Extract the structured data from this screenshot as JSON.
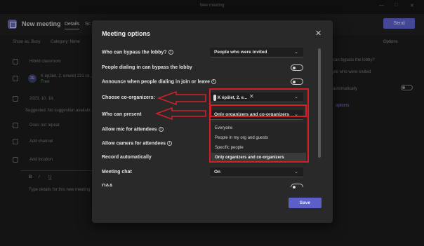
{
  "window": {
    "title": "New meeting"
  },
  "header": {
    "title": "New meeting",
    "tabs": [
      {
        "label": "Details"
      },
      {
        "label": "Sc"
      }
    ],
    "send_label": "Send"
  },
  "background": {
    "show_as": "Show as: Busy",
    "category": "Category: None",
    "title_field": "Hibrid classroom",
    "attendees": "K épület, 2. emelet 221 ok...",
    "attendees_sub": "Free",
    "date": "2023. 10. 18.",
    "suggested": "Suggested: No suggestion availabl...",
    "repeat": "Does not repeat",
    "add_channel": "Add channel",
    "add_location": "Add location",
    "editor_placeholder": "Type details for this new meeting",
    "editor_bold": "B",
    "editor_italic": "I",
    "editor_underline": "U",
    "options_label": "Options",
    "right_bypass_q": "can bypass the lobby?",
    "right_bypass_val": "ple who were invited",
    "right_auto": "automatically",
    "right_more": "options"
  },
  "dialog": {
    "title": "Meeting options",
    "rows": [
      {
        "label": "Who can bypass the lobby?",
        "value": "People who were invited"
      },
      {
        "label": "People dialing in can bypass the lobby"
      },
      {
        "label": "Announce when people dialing in join or leave"
      },
      {
        "label": "Choose co-organizers:",
        "chip": "K épület, 2. e..."
      },
      {
        "label": "Who can present",
        "value": "Only organizers and co-organizers"
      },
      {
        "label": "Allow mic for attendees"
      },
      {
        "label": "Allow camera for attendees"
      },
      {
        "label": "Record automatically"
      },
      {
        "label": "Meeting chat",
        "value": "On"
      },
      {
        "label": "Q&A"
      }
    ],
    "present_options": [
      "Everyone",
      "People in my org and guests",
      "Specific people",
      "Only organizers and co-organizers"
    ],
    "save_label": "Save"
  },
  "colors": {
    "accent": "#5b5fc7",
    "annotation": "#d0202a"
  }
}
